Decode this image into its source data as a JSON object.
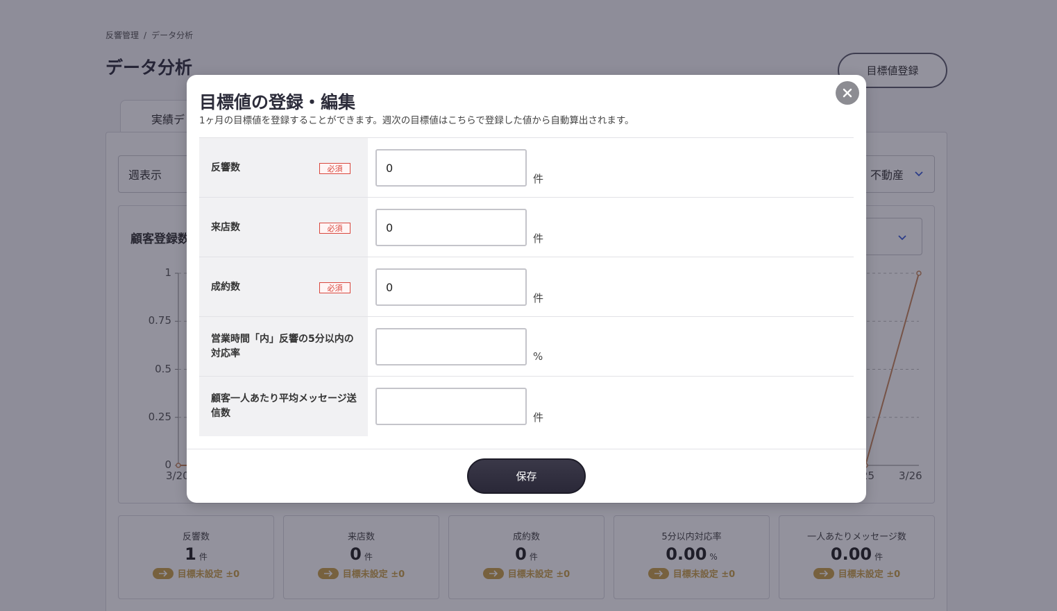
{
  "breadcrumb": {
    "parent": "反響管理",
    "separator": "/",
    "current": "データ分析"
  },
  "page": {
    "title": "データ分析",
    "register_button": "目標値登録",
    "tab_label": "実績デ"
  },
  "filters": {
    "period": "週表示",
    "area": "不動産"
  },
  "chart_section": {
    "title": "顧客登録数"
  },
  "chart_data": {
    "type": "line",
    "x": [
      "3/20",
      "3/25",
      "3/26"
    ],
    "visible_x_ticks": [
      "3/20",
      "25",
      "3/26"
    ],
    "series": [
      {
        "values": [
          0,
          0,
          1
        ]
      }
    ],
    "ylim": [
      0,
      1
    ],
    "yticks": [
      "0",
      "0.25",
      "0.5",
      "0.75",
      "1"
    ],
    "grid": true,
    "colors": {
      "line": "#c8865a"
    }
  },
  "kpis": [
    {
      "label": "反響数",
      "value": "1",
      "unit": "件",
      "target": "目標未設定 ±0"
    },
    {
      "label": "来店数",
      "value": "0",
      "unit": "件",
      "target": "目標未設定 ±0"
    },
    {
      "label": "成約数",
      "value": "0",
      "unit": "件",
      "target": "目標未設定 ±0"
    },
    {
      "label": "5分以内対応率",
      "value": "0.00",
      "unit": "%",
      "target": "目標未設定 ±0"
    },
    {
      "label": "一人あたりメッセージ数",
      "value": "0.00",
      "unit": "件",
      "target": "目標未設定 ±0"
    }
  ],
  "modal": {
    "title": "目標値の登録・編集",
    "description": "1ヶ月の目標値を登録することができます。週次の目標値はこちらで登録した値から自動算出されます。",
    "fields": [
      {
        "label": "反響数",
        "required": "必須",
        "value": "0",
        "unit": "件"
      },
      {
        "label": "来店数",
        "required": "必須",
        "value": "0",
        "unit": "件"
      },
      {
        "label": "成約数",
        "required": "必須",
        "value": "0",
        "unit": "件"
      },
      {
        "label": "営業時間「内」反響の5分以内の対応率",
        "value": "",
        "unit": "%"
      },
      {
        "label": "顧客一人あたり平均メッセージ送信数",
        "value": "",
        "unit": "件"
      }
    ],
    "save_label": "保存"
  },
  "colors": {
    "overlay": "rgba(30,28,50,0.48)",
    "required": "#d9473d",
    "target": "#c9a24a",
    "button_dark": "#2c2a3a"
  }
}
